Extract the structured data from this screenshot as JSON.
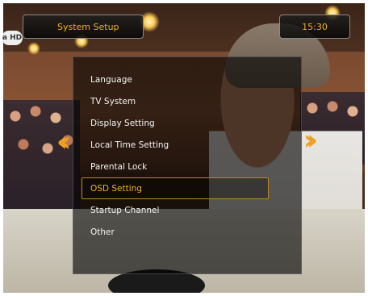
{
  "header": {
    "title": "System Setup",
    "clock": "15:30",
    "logo_text": "a HD"
  },
  "menu": {
    "items": [
      {
        "label": "Language"
      },
      {
        "label": "TV System"
      },
      {
        "label": "Display Setting"
      },
      {
        "label": "Local Time Setting"
      },
      {
        "label": "Parental Lock"
      },
      {
        "label": "OSD Setting"
      },
      {
        "label": "Startup Channel"
      },
      {
        "label": "Other"
      }
    ],
    "selected_index": 5
  },
  "colors": {
    "accent": "#f0b020",
    "text": "#f4f4f4",
    "panel": "#000000"
  }
}
